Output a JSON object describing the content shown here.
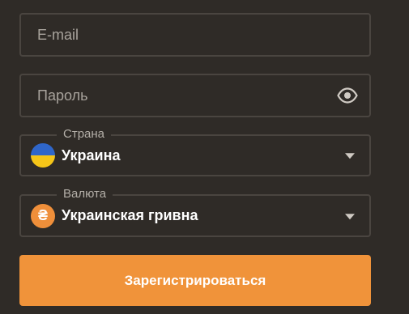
{
  "form": {
    "email": {
      "placeholder": "E-mail",
      "value": ""
    },
    "password": {
      "placeholder": "Пароль",
      "value": "",
      "toggle_icon": "eye-icon"
    },
    "country": {
      "label": "Страна",
      "value": "Украина",
      "icon": "ukraine-flag-icon"
    },
    "currency": {
      "label": "Валюта",
      "value": "Украинская гривна",
      "icon": "hryvnia-icon",
      "symbol": "₴"
    },
    "submit_label": "Зарегистрироваться"
  },
  "colors": {
    "background": "#2f2b27",
    "field_border": "#4a4540",
    "accent": "#f0933a",
    "text": "#ffffff",
    "muted": "#a8a39c"
  }
}
